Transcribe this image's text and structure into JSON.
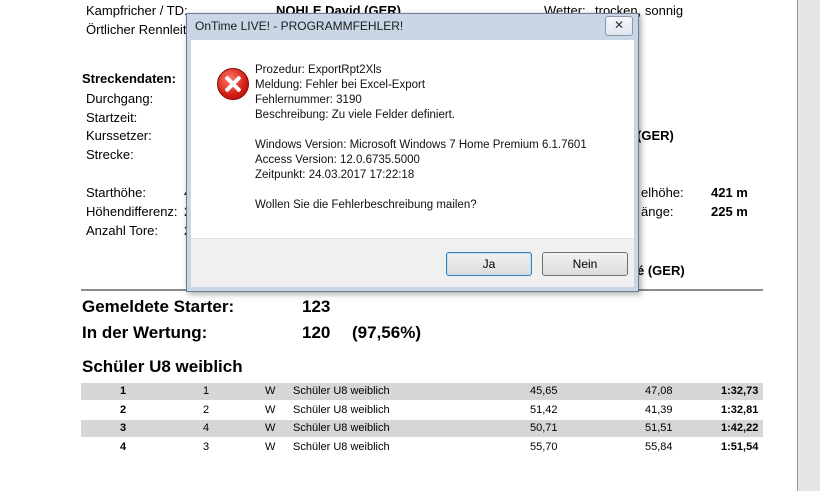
{
  "report": {
    "kampfrichter_label": "Kampfricher / TD:",
    "kampfrichter_value": "NOHLE David (GER)",
    "wetter_label": "Wetter:",
    "wetter_value": "trocken, sonnig",
    "rennleiter_label": "Örtlicher Rennleit",
    "streckendaten_label": "Streckendaten:",
    "durchgang_label": "Durchgang:",
    "startzeit_label": "Startzeit:",
    "kurssetzer_label": "Kurssetzer:",
    "kurssetzer_right": "(GER)",
    "strecke_label": "Strecke:",
    "starthoehe_label": "Starthöhe:",
    "starthoehe_prefix": "4",
    "zielhoehe_label": "elhöhe:",
    "zielhoehe_value": "421 m",
    "hoehendifferenz_label": "Höhendifferenz:",
    "hoehendifferenz_prefix": "2",
    "laenge_label": "änge:",
    "laenge_value": "225 m",
    "anzahl_tore_label": "Anzahl Tore:",
    "anzahl_tore_prefix": "2",
    "vorlaeufer_right": "é (GER)",
    "gemeldete_label": "Gemeldete Starter:",
    "gemeldete_value": "123",
    "wertung_label": "In der Wertung:",
    "wertung_value": "120",
    "wertung_pct": "(97,56%)",
    "category_title": "Schüler U8 weiblich",
    "results": [
      {
        "rank": "1",
        "bib": "1",
        "sex": "W",
        "class": "Schüler U8 weiblich",
        "run1": "45,65",
        "run2": "47,08",
        "total": "1:32,73"
      },
      {
        "rank": "2",
        "bib": "2",
        "sex": "W",
        "class": "Schüler U8 weiblich",
        "run1": "51,42",
        "run2": "41,39",
        "total": "1:32,81"
      },
      {
        "rank": "3",
        "bib": "4",
        "sex": "W",
        "class": "Schüler U8 weiblich",
        "run1": "50,71",
        "run2": "51,51",
        "total": "1:42,22"
      },
      {
        "rank": "4",
        "bib": "3",
        "sex": "W",
        "class": "Schüler U8 weiblich",
        "run1": "55,70",
        "run2": "55,84",
        "total": "1:51,54"
      }
    ]
  },
  "dialog": {
    "title": "OnTime LIVE! - PROGRAMMFEHLER!",
    "close_glyph": "✕",
    "icon": "error-icon",
    "prozedur": "Prozedur: ExportRpt2Xls",
    "meldung": "Meldung: Fehler bei Excel-Export",
    "fehlernummer": "Fehlernummer: 3190",
    "beschreibung": "Beschreibung: Zu viele Felder definiert.",
    "windows_version": "Windows Version: Microsoft Windows 7 Home Premium  6.1.7601",
    "access_version": "Access Version: 12.0.6735.5000",
    "zeitpunkt": "Zeitpunkt: 24.03.2017 17:22:18",
    "frage": "Wollen Sie die Fehlerbeschreibung mailen?",
    "yes_label": "Ja",
    "no_label": "Nein"
  }
}
